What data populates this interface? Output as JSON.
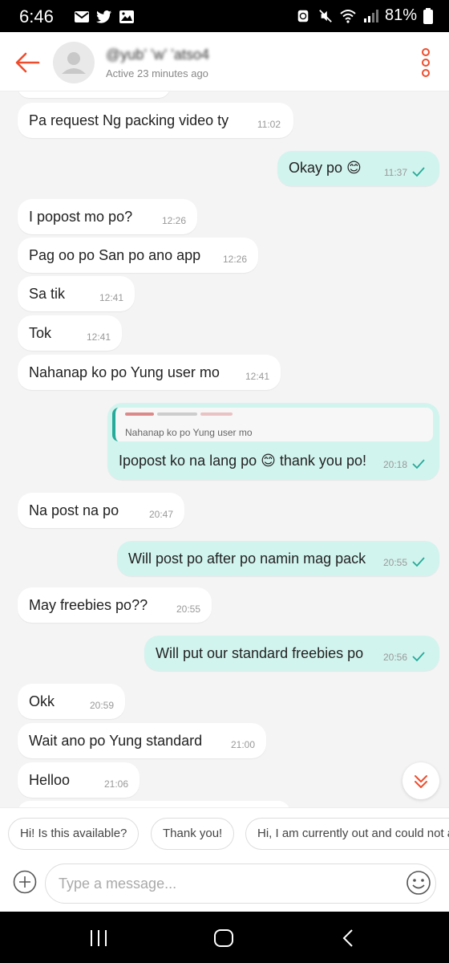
{
  "status_bar": {
    "time": "6:46",
    "battery": "81%",
    "left_icons": [
      "mail-icon",
      "twitter-icon",
      "image-icon"
    ],
    "right_icons": [
      "alarm-icon",
      "mute-icon",
      "wifi-icon",
      "signal-icon",
      "battery-icon"
    ]
  },
  "header": {
    "contact_name": "@yub’ ’w’ ’atso4",
    "contact_status": "Active 23 minutes ago"
  },
  "messages": [
    {
      "side": "in",
      "text": "Pa request Ng packing video ty",
      "time": "11:02"
    },
    {
      "side": "out",
      "text": "Okay po 😊",
      "time": "11:37",
      "read": true
    },
    {
      "side": "in",
      "text": "I popost mo po?",
      "time": "12:26"
    },
    {
      "side": "in",
      "text": "Pag oo po San po ano app",
      "time": "12:26"
    },
    {
      "side": "in",
      "text": "Sa tik",
      "time": "12:41"
    },
    {
      "side": "in",
      "text": "Tok",
      "time": "12:41"
    },
    {
      "side": "in",
      "text": "Nahanap ko po Yung user mo",
      "time": "12:41"
    },
    {
      "side": "out",
      "text": "Ipopost ko na lang po 😊 thank you po!",
      "time": "20:18",
      "read": true,
      "reply_to": "Nahanap ko po Yung user mo"
    },
    {
      "side": "in",
      "text": "Na post na po",
      "time": "20:47"
    },
    {
      "side": "out",
      "text": "Will post po after po namin mag pack",
      "time": "20:55",
      "read": true
    },
    {
      "side": "in",
      "text": "May freebies po??",
      "time": "20:55"
    },
    {
      "side": "out",
      "text": "Will put our standard freebies po",
      "time": "20:56",
      "read": true
    },
    {
      "side": "in",
      "text": "Okk",
      "time": "20:59"
    },
    {
      "side": "in",
      "text": "Wait ano po Yung standard",
      "time": "21:00"
    },
    {
      "side": "in",
      "text": "Helloo",
      "time": "21:06"
    }
  ],
  "quick_replies": [
    "Hi! Is this available?",
    "Thank you!",
    "Hi, I am currently out and could not a"
  ],
  "input": {
    "placeholder": "Type a message..."
  },
  "colors": {
    "accent": "#ee4d2d",
    "outgoing_bubble": "#d2f4ee",
    "check": "#26aa99",
    "chat_bg": "#f4f4f4"
  }
}
